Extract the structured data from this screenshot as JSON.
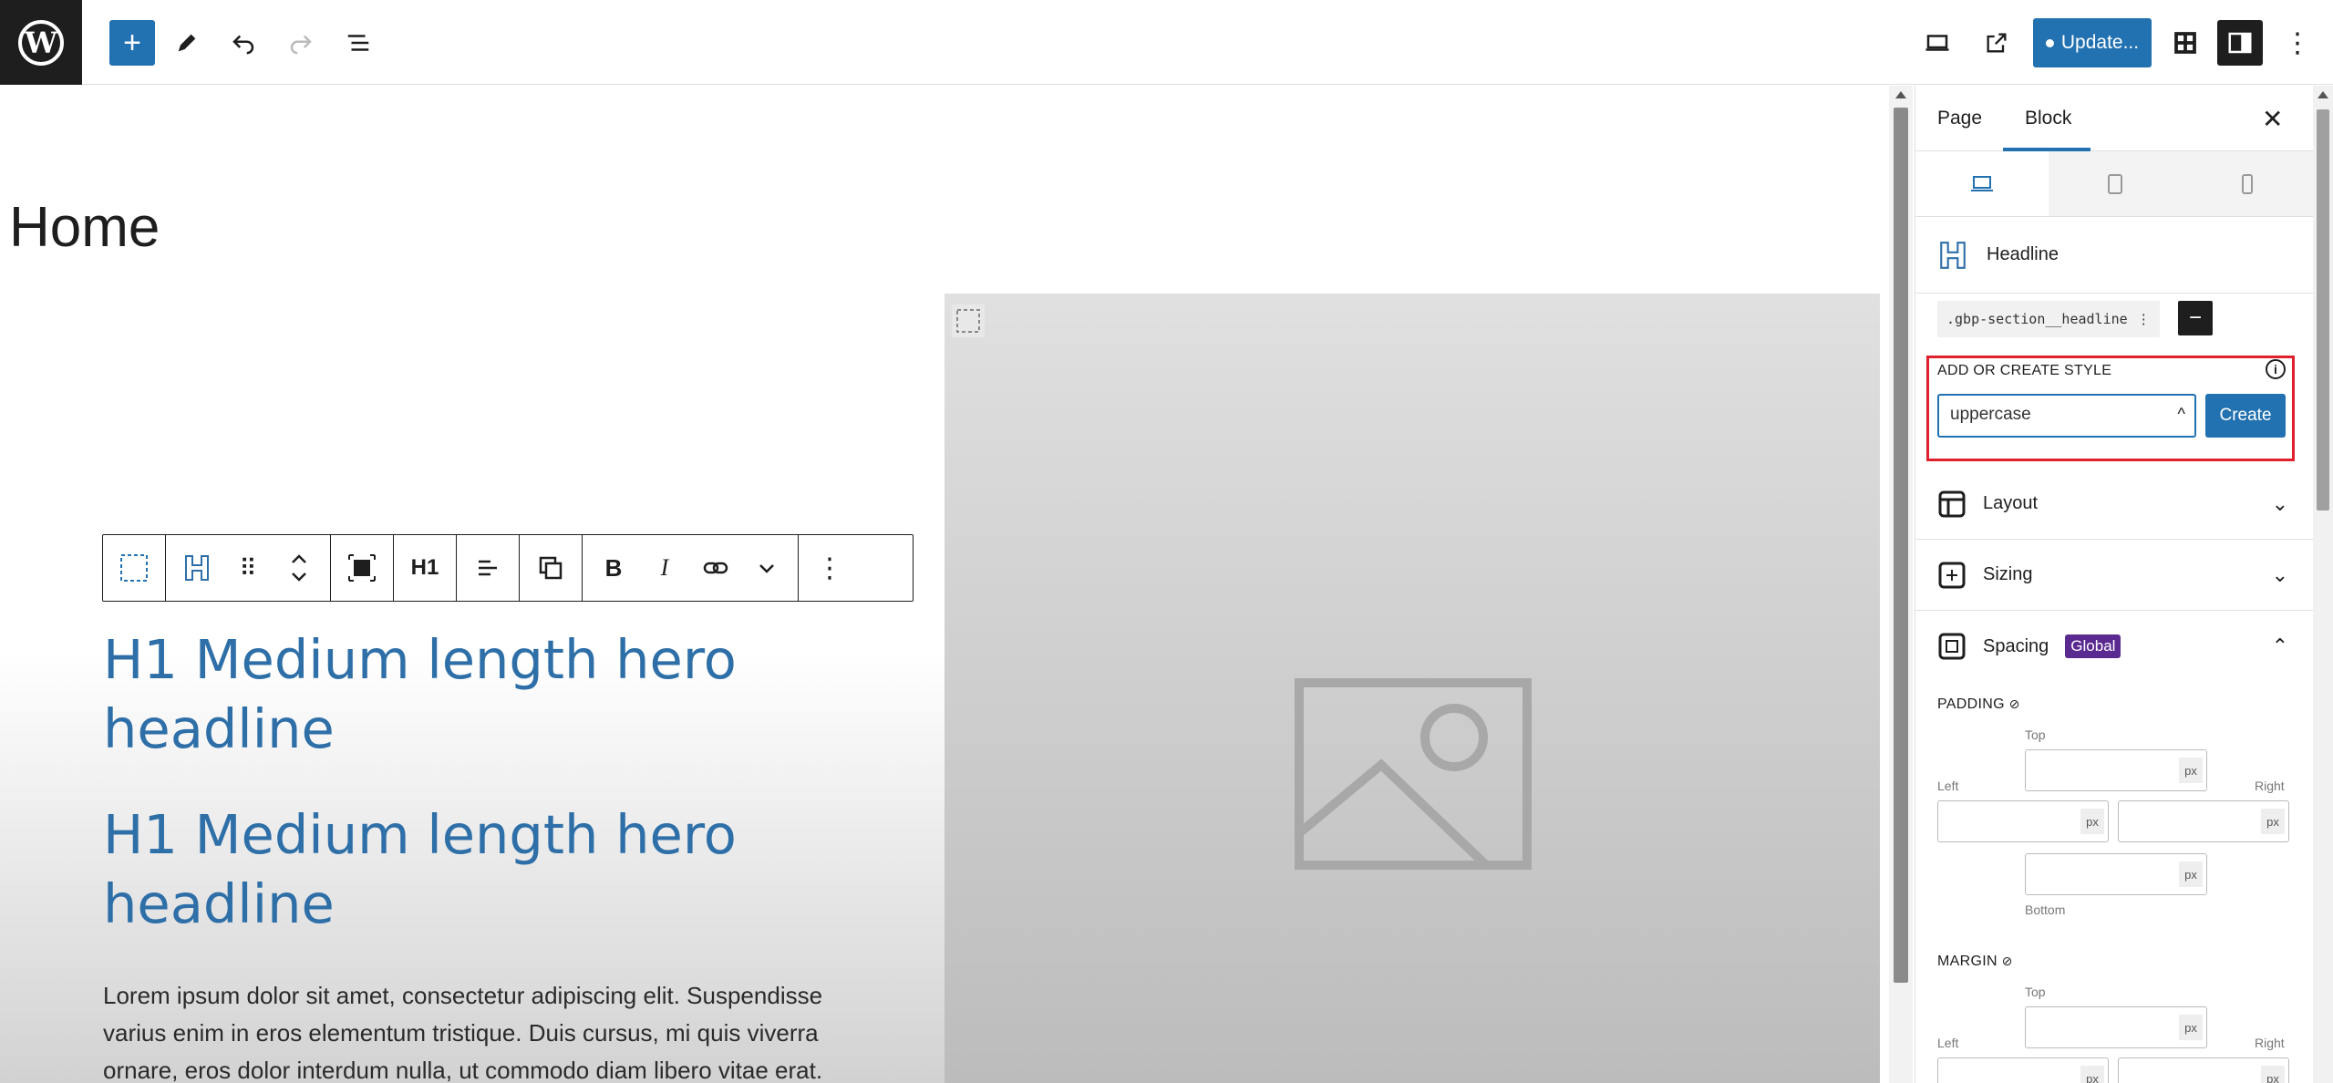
{
  "topbar": {
    "logo": "W",
    "add_icon": "+",
    "update_label": "Update..."
  },
  "canvas": {
    "page_title": "Home",
    "headline_1": "H1 Medium length hero headline",
    "headline_2": "H1 Medium length hero headline",
    "body_text": "Lorem ipsum dolor sit amet, consectetur adipiscing elit. Suspendisse varius enim in eros elementum tristique. Duis cursus, mi quis viverra ornare, eros dolor interdum nulla, ut commodo diam libero vitae erat.",
    "toolbar": {
      "heading_level": "H1",
      "bold": "B",
      "italic": "I"
    }
  },
  "sidebar": {
    "tabs": [
      {
        "label": "Page"
      },
      {
        "label": "Block"
      }
    ],
    "close_icon": "✕",
    "block_name": "Headline",
    "class_chip": ".gbp-section__headline",
    "style": {
      "label": "ADD OR CREATE STYLE",
      "input_value": "uppercase",
      "create_label": "Create"
    },
    "panels": [
      {
        "label": "Layout"
      },
      {
        "label": "Sizing"
      },
      {
        "label": "Spacing",
        "badge": "Global"
      }
    ],
    "padding": {
      "label": "PADDING",
      "top": "Top",
      "left": "Left",
      "right": "Right",
      "bottom": "Bottom",
      "unit": "px"
    },
    "margin": {
      "label": "MARGIN",
      "top": "Top",
      "left": "Left",
      "right": "Right",
      "unit": "px"
    }
  },
  "colors": {
    "accent": "#2271b1",
    "headline": "#2e6fa8",
    "highlight_box": "#e0202e",
    "global_badge": "#5b2a91"
  }
}
